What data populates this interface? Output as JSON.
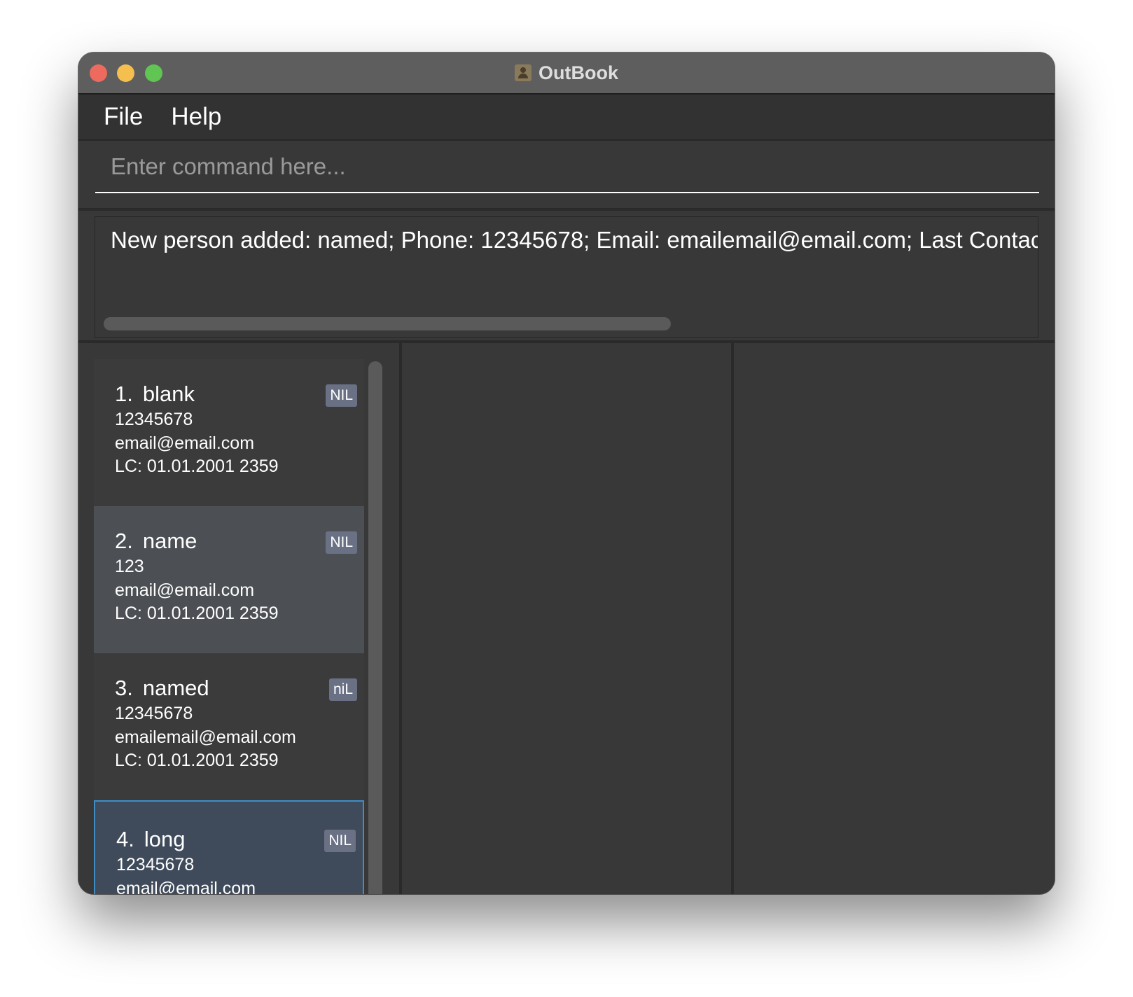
{
  "window": {
    "title": "OutBook"
  },
  "menu": {
    "items": [
      "File",
      "Help"
    ]
  },
  "command": {
    "placeholder": "Enter command here...",
    "value": ""
  },
  "result": {
    "message": "New person added: named; Phone: 12345678; Email: emailemail@email.com; Last Contacte"
  },
  "persons": [
    {
      "index": "1.",
      "name": "blank",
      "phone": "12345678",
      "email": "email@email.com",
      "last_contacted": "LC: 01.01.2001 2359",
      "tag": "NIL"
    },
    {
      "index": "2.",
      "name": "name",
      "phone": "123",
      "email": "email@email.com",
      "last_contacted": "LC: 01.01.2001 2359",
      "tag": "NIL"
    },
    {
      "index": "3.",
      "name": "named",
      "phone": "12345678",
      "email": "emailemail@email.com",
      "last_contacted": "LC: 01.01.2001 2359",
      "tag": "niL"
    },
    {
      "index": "4.",
      "name": "long",
      "phone": "12345678",
      "email": "email@email.com",
      "last_contacted": "",
      "tag": "NIL"
    }
  ],
  "colors": {
    "window_bg": "#383838",
    "titlebar": "#5e5e5e",
    "selected_card": "#3f4b5b",
    "selected_border": "#3f8ec6",
    "hover_card": "#4c5055",
    "tag_bg": "#6a7184",
    "close_button": "#ed6a5e",
    "minimize_button": "#f4bf4f",
    "maximize_button": "#61c554"
  }
}
